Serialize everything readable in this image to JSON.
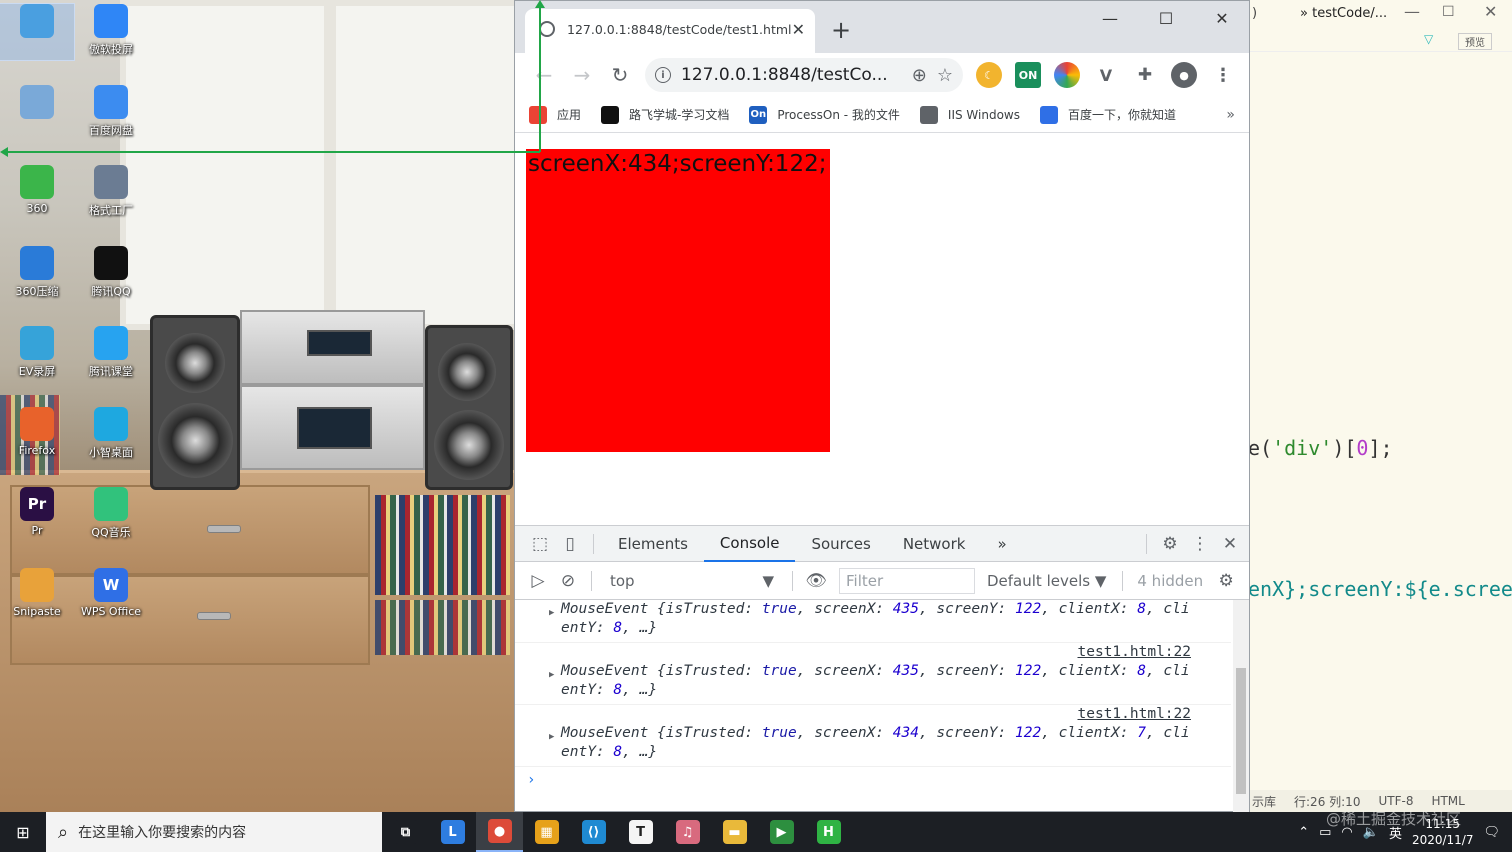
{
  "desktop": {
    "icons": [
      {
        "label": "",
        "icon": "computer-icon",
        "color": "#4a9fe0"
      },
      {
        "label": "傲软投屏",
        "icon": "apowermirror-icon",
        "color": "#2f86f6"
      },
      {
        "label": "",
        "icon": "recycle-bin-icon",
        "color": "#7aa9d8"
      },
      {
        "label": "百度网盘",
        "icon": "baidu-netdisk-icon",
        "color": "#3c8cf0"
      },
      {
        "label": "360",
        "icon": "360-browser-icon",
        "color": "#3bb54a"
      },
      {
        "label": "格式工厂",
        "icon": "format-factory-icon",
        "color": "#6b7c93"
      },
      {
        "label": "360压缩",
        "icon": "360-zip-icon",
        "color": "#2a7bd8"
      },
      {
        "label": "腾讯QQ",
        "icon": "qq-icon",
        "color": "#111111"
      },
      {
        "label": "EV录屏",
        "icon": "ev-recorder-icon",
        "color": "#36a3d9"
      },
      {
        "label": "腾讯课堂",
        "icon": "tencent-classroom-icon",
        "color": "#27a3f0"
      },
      {
        "label": "Firefox",
        "icon": "firefox-icon",
        "color": "#e8622b"
      },
      {
        "label": "小智桌面",
        "icon": "xiaozhi-desktop-icon",
        "color": "#1ea8e0"
      },
      {
        "label": "Pr",
        "icon": "premiere-icon",
        "color": "#2a0f44",
        "glyph": "Pr"
      },
      {
        "label": "QQ音乐",
        "icon": "qq-music-icon",
        "color": "#31c27c"
      },
      {
        "label": "Snipaste",
        "icon": "snipaste-icon",
        "color": "#e8a23a"
      },
      {
        "label": "WPS Office",
        "icon": "wps-icon",
        "color": "#2f6fe6",
        "glyph": "W"
      }
    ]
  },
  "editor": {
    "tab_label": "testCode/...",
    "preview_label": "预览",
    "code_line1": "e('div')[0];",
    "code_line2": "enX};screenY:${e.scree",
    "status": {
      "repo": "示库",
      "position": "行:26 列:10",
      "encoding": "UTF-8",
      "lang": "HTML"
    }
  },
  "browser": {
    "tab_title": "127.0.0.1:8848/testCode/test1.html",
    "url": "127.0.0.1:8848/testCo...",
    "ext_on_label": "ON",
    "bookmarks": [
      {
        "label": "应用",
        "icon": "apps-grid-icon",
        "color": "#ea4335"
      },
      {
        "label": "路飞学城-学习文档",
        "icon": "luffy-icon",
        "color": "#111111"
      },
      {
        "label": "ProcessOn - 我的文件",
        "icon": "processon-icon",
        "color": "#1f5fbf",
        "glyph": "On"
      },
      {
        "label": "IIS Windows",
        "icon": "globe-icon",
        "color": "#5f6368"
      },
      {
        "label": "百度一下，你就知道",
        "icon": "baidu-paw-icon",
        "color": "#2f6fe6"
      }
    ],
    "page_text": "screenX:434;screenY:122;",
    "box_color": "#ff0000"
  },
  "devtools": {
    "tabs": [
      "Elements",
      "Console",
      "Sources",
      "Network"
    ],
    "active_tab": "Console",
    "context": "top",
    "filter_placeholder": "Filter",
    "levels": "Default levels",
    "hidden": "4 hidden",
    "logs": [
      {
        "source": "",
        "event": "MouseEvent",
        "isTrusted": "true",
        "screenX": "435",
        "screenY": "122",
        "clientX": "8",
        "clientY": "8"
      },
      {
        "source": "test1.html:22",
        "event": "MouseEvent",
        "isTrusted": "true",
        "screenX": "435",
        "screenY": "122",
        "clientX": "8",
        "clientY": "8"
      },
      {
        "source": "test1.html:22",
        "event": "MouseEvent",
        "isTrusted": "true",
        "screenX": "434",
        "screenY": "122",
        "clientX": "7",
        "clientY": "8"
      }
    ]
  },
  "taskbar": {
    "search_placeholder": "在这里输入你要搜索的内容",
    "apps": [
      {
        "icon": "task-view-icon",
        "color": "#1c1f24",
        "glyph": "⧉"
      },
      {
        "icon": "lenovo-icon",
        "color": "#2e7de0",
        "glyph": "L"
      },
      {
        "icon": "chrome-icon",
        "color": "#dd4b39",
        "glyph": "●",
        "active": true
      },
      {
        "icon": "store-icon",
        "color": "#e6a11a",
        "glyph": "▦"
      },
      {
        "icon": "vscode-icon",
        "color": "#1f8ad2",
        "glyph": "⟨⟩"
      },
      {
        "icon": "typora-icon",
        "color": "#f5f5f5",
        "glyph": "T"
      },
      {
        "icon": "music-app-icon",
        "color": "#d86a7e",
        "glyph": "♫"
      },
      {
        "icon": "file-explorer-icon",
        "color": "#e9b93a",
        "glyph": "▬"
      },
      {
        "icon": "media-player-icon",
        "color": "#2d8f3f",
        "glyph": "▶"
      },
      {
        "icon": "hbuilder-icon",
        "color": "#2fb344",
        "glyph": "H"
      }
    ],
    "ime": "英",
    "time": "11:15",
    "date": "2020/11/7"
  },
  "watermark": "@稀土掘金技术社区"
}
